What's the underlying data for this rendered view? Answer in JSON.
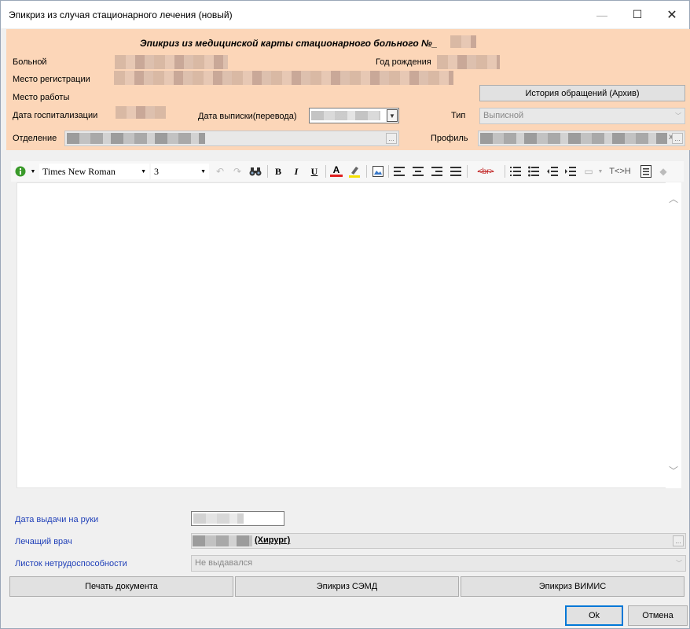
{
  "window": {
    "title": "Эпикриз из случая стационарного лечения (новый)"
  },
  "header": {
    "title": "Эпикриз из медицинской карты стационарного больного №_",
    "patient_label": "Больной",
    "birth_year_label": "Год рождения",
    "registration_label": "Место регистрации",
    "work_label": "Место работы",
    "history_button": "История обращений (Архив)",
    "hosp_date_label": "Дата госпитализации",
    "discharge_date_label": "Дата выписки(перевода)",
    "type_label": "Тип",
    "type_value": "Выписной",
    "department_label": "Отделение",
    "profile_label": "Профиль"
  },
  "toolbar": {
    "font_name": "Times New Roman",
    "font_size": "3",
    "bold": "B",
    "italic": "I",
    "underline": "U",
    "font_color": "A",
    "br_label": "<br>",
    "tag_swap": "T<>H"
  },
  "footer": {
    "issue_date_label": "Дата выдачи на руки",
    "doctor_label": "Лечащий врач",
    "doctor_role": "(Хирург)",
    "sick_leave_label": "Листок нетрудоспособности",
    "sick_leave_value": "Не выдавался",
    "print_button": "Печать документа",
    "semd_button": "Эпикриз СЭМД",
    "vimis_button": "Эпикриз ВИМИС",
    "ok_button": "Ok",
    "cancel_button": "Отмена"
  }
}
